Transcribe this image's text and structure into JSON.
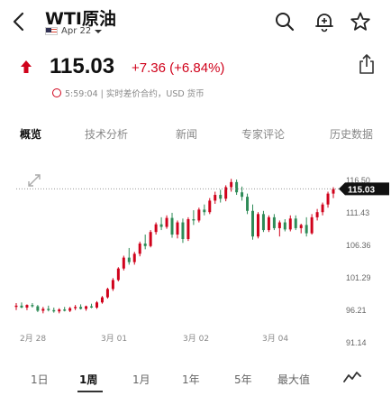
{
  "header": {
    "back_icon": "chevron-left-icon",
    "title": "WTI原油",
    "date_selector": "Apr 22",
    "flag_icon": "us-flag-icon",
    "actions": [
      "search-icon",
      "bell-plus-icon",
      "star-icon"
    ]
  },
  "quote": {
    "direction_icon": "arrow-up-icon",
    "price": "115.03",
    "change": "+7.36 (+6.84%)",
    "status": "5:59:04 | 实时差价合约，USD 货币",
    "share_icon": "share-icon",
    "up_color": "#d0021b",
    "down_color": "#2e8b57"
  },
  "tabs": [
    "概览",
    "技术分析",
    "新闻",
    "专家评论",
    "历史数据"
  ],
  "active_tab": "概览",
  "chart_data": {
    "type": "candlestick",
    "last_price_label": "115.03",
    "y_ticks": [
      "116.50",
      "111.43",
      "106.36",
      "101.29",
      "96.21",
      "91.14"
    ],
    "x_ticks": [
      "2月 28",
      "3月 01",
      "3月 02",
      "3月 04"
    ],
    "ylim": [
      91.14,
      116.5
    ],
    "grid": false,
    "candles": [
      [
        96.6,
        97.2,
        96.1,
        96.8
      ],
      [
        96.8,
        97.3,
        96.4,
        96.5
      ],
      [
        96.5,
        97.0,
        96.1,
        96.9
      ],
      [
        96.9,
        97.2,
        96.5,
        96.7
      ],
      [
        96.7,
        96.9,
        95.8,
        96.0
      ],
      [
        96.0,
        96.6,
        95.6,
        96.3
      ],
      [
        96.3,
        96.8,
        95.9,
        96.1
      ],
      [
        96.1,
        96.5,
        95.7,
        95.9
      ],
      [
        95.9,
        96.4,
        95.6,
        96.2
      ],
      [
        96.2,
        96.6,
        95.9,
        96.0
      ],
      [
        96.0,
        96.6,
        95.8,
        96.4
      ],
      [
        96.4,
        96.9,
        96.1,
        96.6
      ],
      [
        96.6,
        97.0,
        96.2,
        96.3
      ],
      [
        96.3,
        96.8,
        96.0,
        96.7
      ],
      [
        96.7,
        97.1,
        96.4,
        96.5
      ],
      [
        96.5,
        97.5,
        96.3,
        97.3
      ],
      [
        97.3,
        98.3,
        97.1,
        98.1
      ],
      [
        98.1,
        99.6,
        97.9,
        99.4
      ],
      [
        99.4,
        101.1,
        99.1,
        100.8
      ],
      [
        100.8,
        102.8,
        100.6,
        102.6
      ],
      [
        102.6,
        104.6,
        102.3,
        104.3
      ],
      [
        104.3,
        105.8,
        103.2,
        103.6
      ],
      [
        103.6,
        105.2,
        103.2,
        104.9
      ],
      [
        104.9,
        106.8,
        104.5,
        106.5
      ],
      [
        106.5,
        107.9,
        105.6,
        106.1
      ],
      [
        106.1,
        108.6,
        105.9,
        108.3
      ],
      [
        108.3,
        109.8,
        107.9,
        109.5
      ],
      [
        109.5,
        110.6,
        108.6,
        109.1
      ],
      [
        109.1,
        110.9,
        108.8,
        110.5
      ],
      [
        110.5,
        111.3,
        107.4,
        107.9
      ],
      [
        107.9,
        110.1,
        107.3,
        109.8
      ],
      [
        109.8,
        110.4,
        106.6,
        107.2
      ],
      [
        107.2,
        110.6,
        106.9,
        110.3
      ],
      [
        110.3,
        111.7,
        109.4,
        110.1
      ],
      [
        110.1,
        112.1,
        109.8,
        111.8
      ],
      [
        111.8,
        112.6,
        110.9,
        111.4
      ],
      [
        111.4,
        113.6,
        111.1,
        113.2
      ],
      [
        113.2,
        114.6,
        112.7,
        114.1
      ],
      [
        114.1,
        114.9,
        112.9,
        113.5
      ],
      [
        113.5,
        115.6,
        113.1,
        115.3
      ],
      [
        115.3,
        116.6,
        114.6,
        116.1
      ],
      [
        116.1,
        116.5,
        114.1,
        114.5
      ],
      [
        114.5,
        115.4,
        113.2,
        113.8
      ],
      [
        113.8,
        114.3,
        111.1,
        111.6
      ],
      [
        111.6,
        112.6,
        107.1,
        107.6
      ],
      [
        107.6,
        111.4,
        107.3,
        111.1
      ],
      [
        111.1,
        111.6,
        108.3,
        108.6
      ],
      [
        108.6,
        110.9,
        108.3,
        110.6
      ],
      [
        110.6,
        111.1,
        108.6,
        108.9
      ],
      [
        108.9,
        110.1,
        107.6,
        109.8
      ],
      [
        109.8,
        110.3,
        108.4,
        108.7
      ],
      [
        108.7,
        110.9,
        108.4,
        110.4
      ],
      [
        110.4,
        110.9,
        108.6,
        108.9
      ],
      [
        108.9,
        109.6,
        108.1,
        109.4
      ],
      [
        109.4,
        110.6,
        107.6,
        108.1
      ],
      [
        108.1,
        111.1,
        107.9,
        110.6
      ],
      [
        110.6,
        111.9,
        110.1,
        111.4
      ],
      [
        111.4,
        112.9,
        110.9,
        112.6
      ],
      [
        112.6,
        114.6,
        112.1,
        114.3
      ],
      [
        114.3,
        115.3,
        113.6,
        115.03
      ]
    ]
  },
  "ranges": [
    "1日",
    "1周",
    "1月",
    "1年",
    "5年",
    "最大值"
  ],
  "active_range": "1周",
  "line_icon": "line-chart-icon",
  "expand_icon": "expand-icon"
}
